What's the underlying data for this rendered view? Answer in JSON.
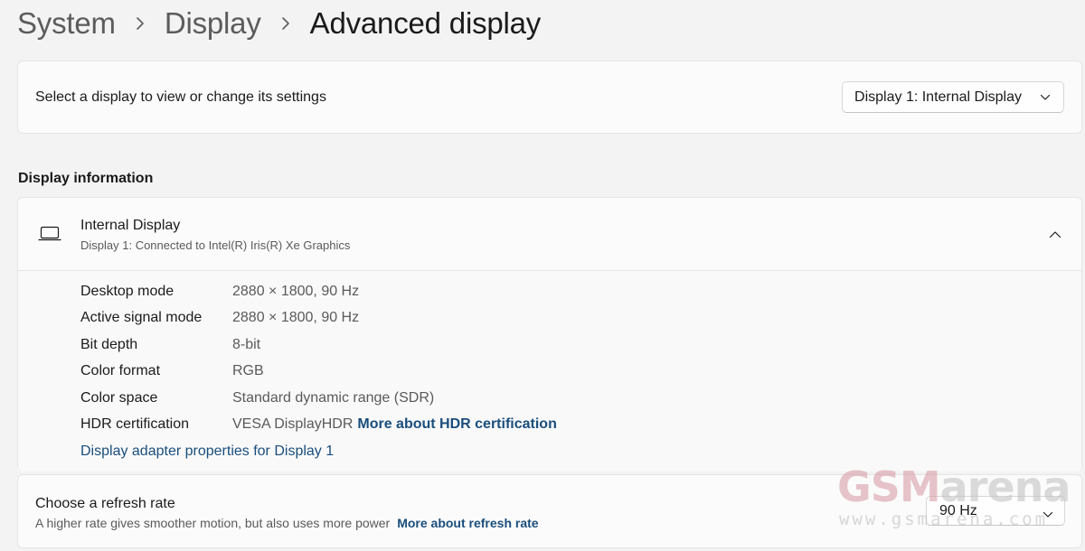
{
  "breadcrumb": [
    {
      "label": "System"
    },
    {
      "label": "Display"
    },
    {
      "label": "Advanced display"
    }
  ],
  "select_display": {
    "label": "Select a display to view or change its settings",
    "value": "Display 1: Internal Display"
  },
  "display_information": {
    "heading": "Display information",
    "title": "Internal Display",
    "subtitle": "Display 1: Connected to Intel(R) Iris(R) Xe Graphics",
    "rows": [
      {
        "key": "Desktop mode",
        "value": "2880 × 1800, 90 Hz"
      },
      {
        "key": "Active signal mode",
        "value": "2880 × 1800, 90 Hz"
      },
      {
        "key": "Bit depth",
        "value": "8-bit"
      },
      {
        "key": "Color format",
        "value": "RGB"
      },
      {
        "key": "Color space",
        "value": "Standard dynamic range (SDR)"
      },
      {
        "key": "HDR certification",
        "value": "VESA DisplayHDR",
        "link": "More about HDR certification"
      }
    ],
    "adapter_link": "Display adapter properties for Display 1"
  },
  "refresh_rate": {
    "title": "Choose a refresh rate",
    "description": "A higher rate gives smoother motion, but also uses more power",
    "link": "More about refresh rate",
    "value": "90 Hz"
  },
  "watermark": {
    "logo_gsm": "GSM",
    "logo_arena": "arena",
    "url": "www.gsmarena.com"
  },
  "colors": {
    "background": "#f3f3f3",
    "card": "#fbfbfb",
    "link": "#1a4e7c",
    "secondary_text": "#5a5a5a"
  },
  "icons": {
    "breadcrumb_separator": "chevron-right-icon",
    "dropdown": "chevron-down-icon",
    "display_device": "laptop-icon",
    "expander": "chevron-up-icon"
  }
}
